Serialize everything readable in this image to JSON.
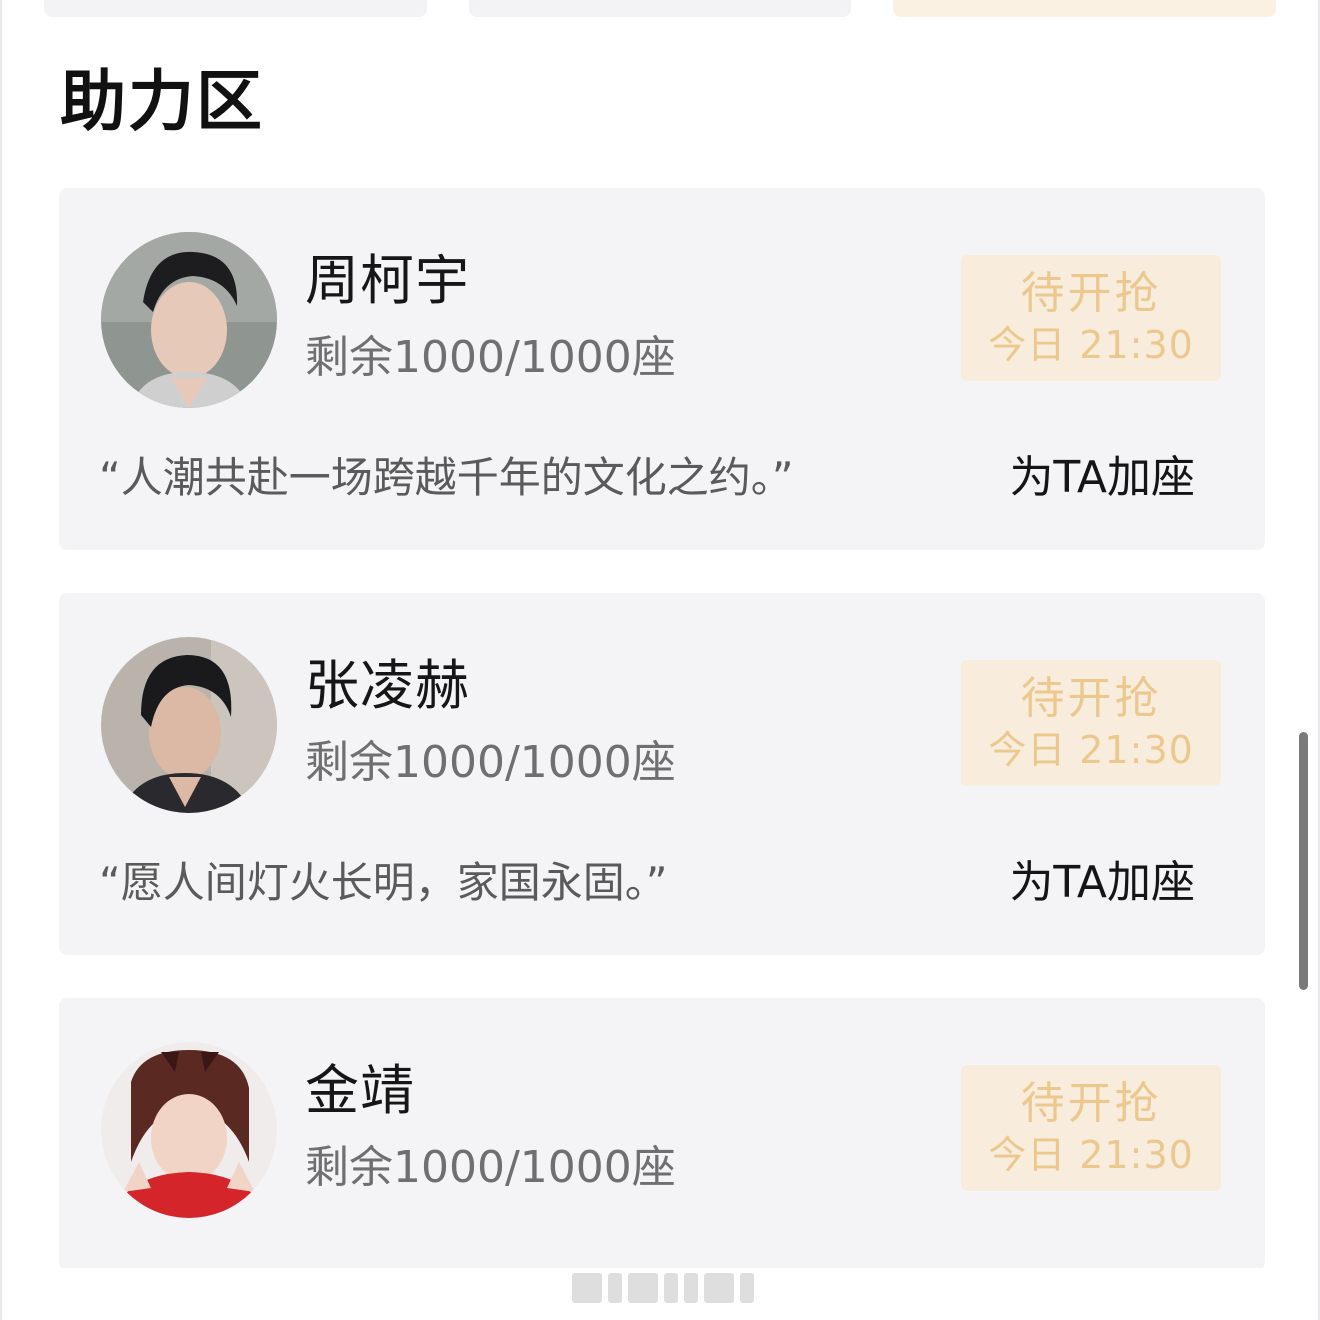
{
  "section": {
    "title": "助力区"
  },
  "cards": [
    {
      "name": "周柯宇",
      "seats": "剩余1000/1000座",
      "status": "待开抢",
      "time": "今日 21:30",
      "quote": "“人潮共赴一场跨越千年的文化之约。”",
      "action": "为TA加座"
    },
    {
      "name": "张凌赫",
      "seats": "剩余1000/1000座",
      "status": "待开抢",
      "time": "今日 21:30",
      "quote": "“愿人间灯火长明，家国永固。”",
      "action": "为TA加座"
    },
    {
      "name": "金靖",
      "seats": "剩余1000/1000座",
      "status": "待开抢",
      "time": "今日 21:30"
    }
  ],
  "colors": {
    "card_bg": "#f4f4f6",
    "button_bg": "#f8eddc",
    "button_text": "#ecc88f",
    "quote_text": "#5a5a5a"
  }
}
